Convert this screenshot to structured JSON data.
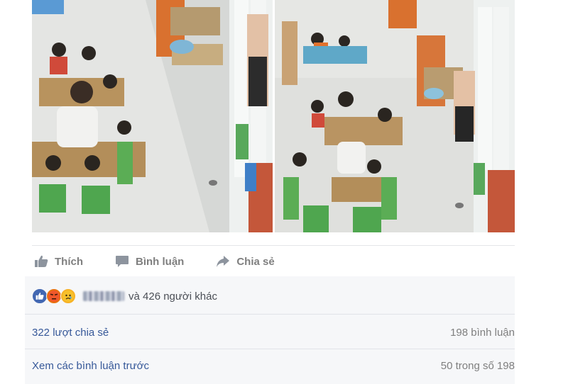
{
  "actions": {
    "like_label": "Thích",
    "comment_label": "Bình luận",
    "share_label": "Chia sẻ"
  },
  "reactions": {
    "icons": [
      "like-reaction",
      "angry-reaction",
      "sad-reaction"
    ],
    "others_text": "và 426 người khác"
  },
  "stats": {
    "shares_text": "322 lượt chia sẻ",
    "comments_text": "198 bình luận"
  },
  "comments": {
    "view_previous_text": "Xem các bình luận trước",
    "count_text": "50 trong số 198"
  },
  "colors": {
    "link": "#365899",
    "muted": "#7f7f7f",
    "like_blue": "#4267b2",
    "angry": "#e9710f",
    "sad": "#f7b125",
    "panel_bg": "#f6f7f9"
  }
}
